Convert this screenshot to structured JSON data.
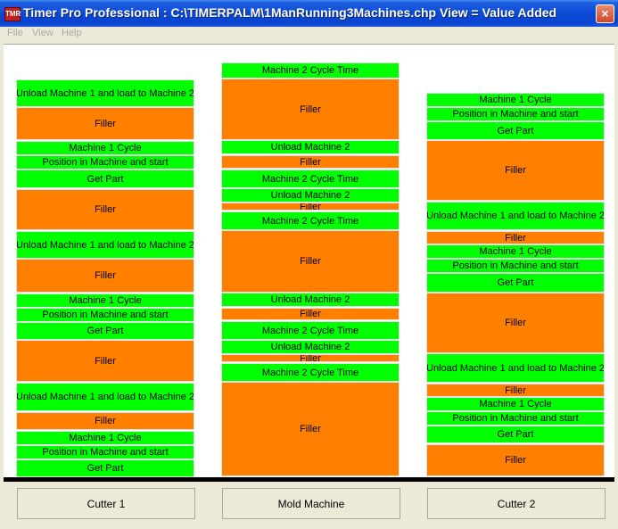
{
  "window": {
    "title": "Timer Pro Professional : C:\\TIMERPALM\\1ManRunning3Machines.chp      View = Value Added",
    "icon_text": "TMR",
    "close_label": "×"
  },
  "menu": {
    "items": [
      "File",
      "View",
      "Help"
    ]
  },
  "colors": {
    "value_added": "#00ff00",
    "filler": "#ff8000"
  },
  "columns": [
    {
      "name": "Cutter 1",
      "blocks": [
        {
          "label": "Unload Machine 1 and load to Machine 2",
          "kind": "value"
        },
        {
          "label": "Filler",
          "kind": "filler"
        },
        {
          "label": "Machine 1 Cycle",
          "kind": "value"
        },
        {
          "label": "Position in Machine and start",
          "kind": "value"
        },
        {
          "label": "Get Part",
          "kind": "value"
        },
        {
          "label": "Filler",
          "kind": "filler"
        },
        {
          "label": "Unload Machine 1 and load to Machine 2",
          "kind": "value"
        },
        {
          "label": "Filler",
          "kind": "filler"
        },
        {
          "label": "Machine 1 Cycle",
          "kind": "value"
        },
        {
          "label": "Position in Machine and start",
          "kind": "value"
        },
        {
          "label": "Get Part",
          "kind": "value"
        },
        {
          "label": "Filler",
          "kind": "filler"
        },
        {
          "label": "Unload Machine 1 and load to Machine 2",
          "kind": "value"
        },
        {
          "label": "Filler",
          "kind": "filler"
        },
        {
          "label": "Machine 1 Cycle",
          "kind": "value"
        },
        {
          "label": "Position in Machine and start",
          "kind": "value"
        },
        {
          "label": "Get Part",
          "kind": "value"
        }
      ]
    },
    {
      "name": "Mold Machine",
      "blocks": [
        {
          "label": "Machine 2 Cycle Time",
          "kind": "value"
        },
        {
          "label": "Filler",
          "kind": "filler"
        },
        {
          "label": "Unload Machine 2",
          "kind": "value"
        },
        {
          "label": "Filler",
          "kind": "filler"
        },
        {
          "label": "Machine 2 Cycle Time",
          "kind": "value"
        },
        {
          "label": "Unload Machine 2",
          "kind": "value"
        },
        {
          "label": "Filler",
          "kind": "filler"
        },
        {
          "label": "Machine 2 Cycle Time",
          "kind": "value"
        },
        {
          "label": "Filler",
          "kind": "filler"
        },
        {
          "label": "Unload Machine 2",
          "kind": "value"
        },
        {
          "label": "Filler",
          "kind": "filler"
        },
        {
          "label": "Machine 2 Cycle Time",
          "kind": "value"
        },
        {
          "label": "Unload Machine 2",
          "kind": "value"
        },
        {
          "label": "Filler",
          "kind": "filler"
        },
        {
          "label": "Machine 2 Cycle Time",
          "kind": "value"
        },
        {
          "label": "Filler",
          "kind": "filler"
        }
      ]
    },
    {
      "name": "Cutter 2",
      "blocks": [
        {
          "label": "Machine 1 Cycle",
          "kind": "value"
        },
        {
          "label": "Position in Machine and start",
          "kind": "value"
        },
        {
          "label": "Get Part",
          "kind": "value"
        },
        {
          "label": "Filler",
          "kind": "filler"
        },
        {
          "label": "Unload Machine 1 and load to Machine 2",
          "kind": "value"
        },
        {
          "label": "Filler",
          "kind": "filler"
        },
        {
          "label": "Machine 1 Cycle",
          "kind": "value"
        },
        {
          "label": "Position in Machine and start",
          "kind": "value"
        },
        {
          "label": "Get Part",
          "kind": "value"
        },
        {
          "label": "Filler",
          "kind": "filler"
        },
        {
          "label": "Unload Machine 1 and load to Machine 2",
          "kind": "value"
        },
        {
          "label": "Filler",
          "kind": "filler"
        },
        {
          "label": "Machine 1 Cycle",
          "kind": "value"
        },
        {
          "label": "Position in Machine and start",
          "kind": "value"
        },
        {
          "label": "Get Part",
          "kind": "value"
        },
        {
          "label": "Filler",
          "kind": "filler"
        }
      ]
    }
  ]
}
